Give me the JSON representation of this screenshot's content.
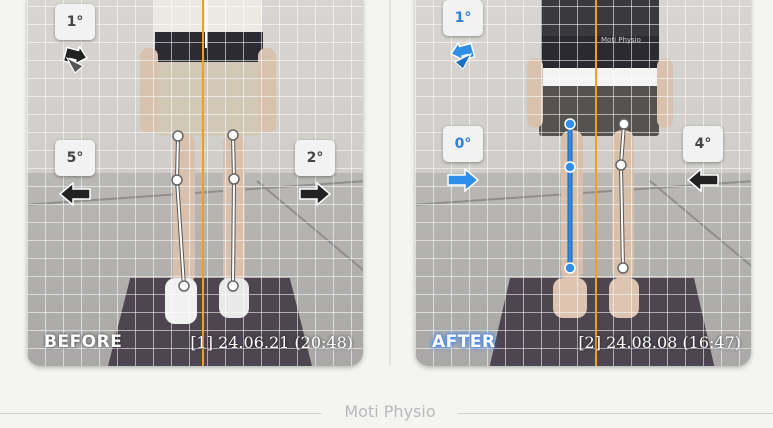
{
  "before": {
    "label": "BEFORE",
    "timestamp": "[1] 24.06.21 (20:48)",
    "top_angle": "1°",
    "left_angle": "5°",
    "right_angle": "2°",
    "top_icon": "rotate-turn-icon",
    "left_icon": "arrow-left-icon",
    "right_icon": "arrow-right-icon"
  },
  "after": {
    "label": "AFTER",
    "timestamp": "[2] 24.08.08 (16:47)",
    "top_angle": "1°",
    "left_angle": "0°",
    "right_angle": "4°",
    "top_icon": "rotate-turn-icon",
    "left_icon": "arrow-right-icon",
    "right_icon": "arrow-left-icon",
    "shirt_text": "Moti Physio"
  },
  "footer": {
    "brand": "Moti Physio"
  },
  "colors": {
    "center_line": "#f0a020",
    "leg_line_after": "#2f7fd6",
    "leg_line_before": "#ffffff",
    "icon_blue": "#2f8fe8",
    "icon_dark": "#222222"
  }
}
